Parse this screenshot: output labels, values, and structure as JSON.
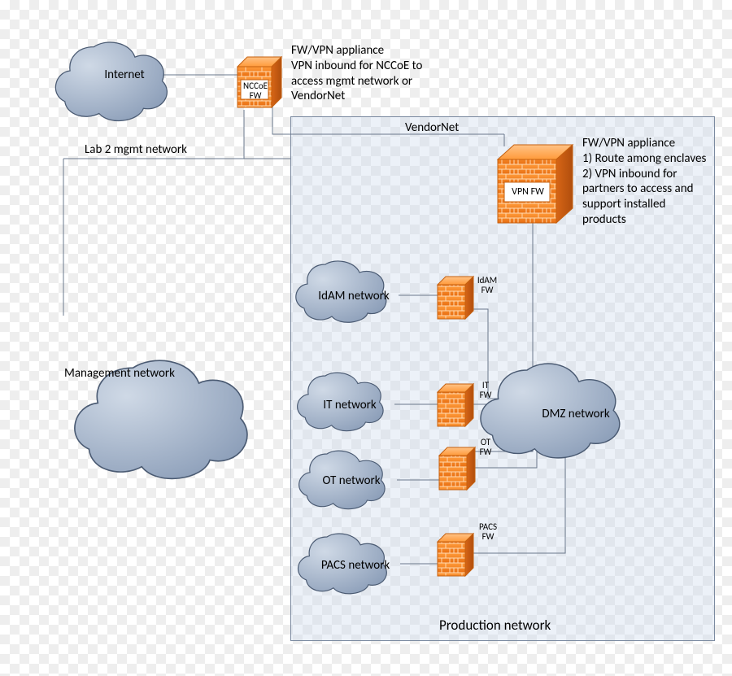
{
  "clouds": {
    "internet": "Internet",
    "management": "Management network",
    "idam": "IdAM network",
    "it": "IT network",
    "ot": "OT network",
    "pacs": "PACS network",
    "dmz": "DMZ  network"
  },
  "firewalls": {
    "nccoe": "NCCoE\nFW",
    "vpn": "VPN FW",
    "idam": "IdAM\nFW",
    "it": "IT\nFW",
    "ot": "OT\nFW",
    "pacs": "PACS\nFW"
  },
  "labels": {
    "lab2": "Lab 2  mgmt network",
    "vendornet": "VendorNet",
    "production": "Production network",
    "note_top": "FW/VPN appliance\nVPN inbound for NCCoE to\naccess mgmt network or\nVendorNet",
    "note_right": "FW/VPN appliance\n1) Route among enclaves\n2) VPN inbound for\n    partners to access and\n    support installed\n    products"
  }
}
